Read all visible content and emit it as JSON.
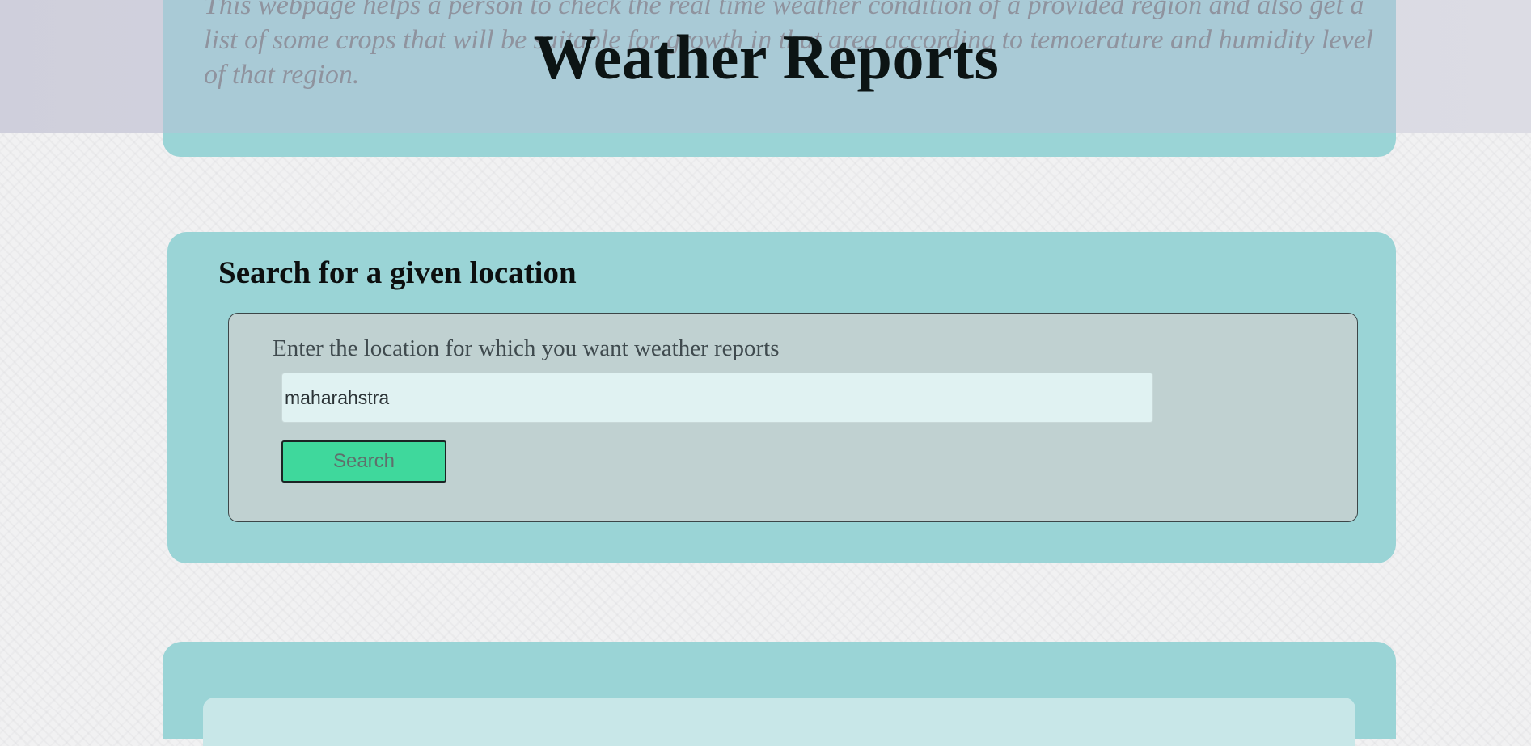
{
  "header": {
    "description": "This webpage helps a person to check the real time weather condition of a provided region and also get a list of some crops that will be suitable for growth in that area according to temoerature and humidity level of that region.",
    "title": "Weather Reports"
  },
  "search": {
    "heading": "Search for a given location",
    "label": "Enter the location for which you want weather reports",
    "input_value": "maharahstra",
    "button_label": "Search"
  },
  "colors": {
    "card_background": "#9ad4d6",
    "form_background": "#c0d1d1",
    "input_background": "#e0f2f2",
    "button_background": "#3fd89c",
    "title_color": "#0c1414"
  }
}
